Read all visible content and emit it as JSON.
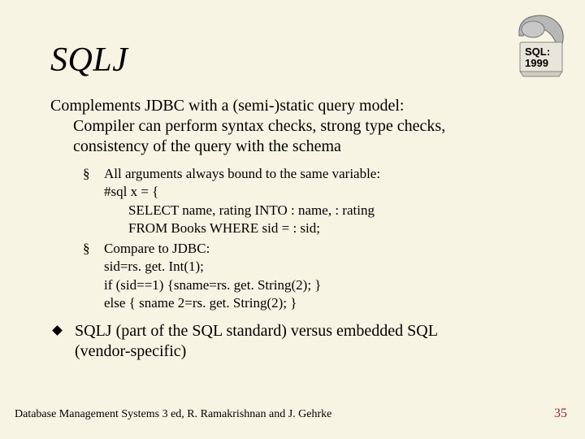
{
  "title": "SQLJ",
  "logo": {
    "label1": "SQL:",
    "label2": "1999"
  },
  "para1_line1": "Complements JDBC with a (semi-)static query model:",
  "para1_line2": "Compiler can perform syntax checks, strong type checks,",
  "para1_line3": "consistency of the query with the schema",
  "sub": {
    "item1": {
      "head": "All arguments always bound to the same variable:",
      "l1": "#sql x = {",
      "l2": "SELECT name, rating INTO : name, : rating",
      "l3": "FROM Books WHERE sid = : sid;"
    },
    "item2": {
      "head": "Compare to JDBC:",
      "l1": "sid=rs. get. Int(1);",
      "l2": "if (sid==1) {sname=rs. get. String(2); }",
      "l3": "else { sname 2=rs. get. String(2); }"
    }
  },
  "diamond": {
    "l1": "SQLJ (part of the SQL standard) versus embedded SQL",
    "l2": "(vendor-specific)"
  },
  "footer": "Database Management Systems 3 ed,  R. Ramakrishnan and J. Gehrke",
  "pagenum": "35"
}
